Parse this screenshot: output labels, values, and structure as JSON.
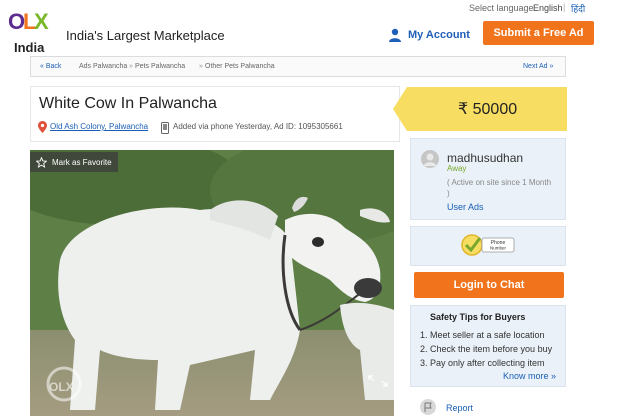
{
  "header": {
    "logo_text": "OLX",
    "country": "India",
    "tagline": "India's Largest Marketplace",
    "language_label": "Select language",
    "lang_english": "English",
    "lang_separator": "|",
    "lang_hindi": "हिंदी",
    "my_account": "My Account",
    "submit_ad": "Submit a Free Ad"
  },
  "breadcrumb": {
    "back": "« Back",
    "items": [
      "Ads Palwancha",
      "Pets Palwancha",
      "Other Pets Palwancha"
    ],
    "separator": "»",
    "next": "Next Ad »"
  },
  "ad": {
    "title": "White Cow In Palwancha",
    "location": "Old Ash Colony, Palwancha",
    "added": "Added via phone Yesterday, Ad ID: 1095305661",
    "price": "₹ 50000",
    "favorite": "Mark as Favorite",
    "watermark": "OLX"
  },
  "seller": {
    "name": "madhusudhan",
    "status": "Away",
    "active_since": "( Active on site since 1 Month )",
    "user_ads": "User Ads",
    "verified_badge": "Phone Number Verified"
  },
  "chat_button": "Login to Chat",
  "safety": {
    "title": "Safety Tips for Buyers",
    "tips": [
      "1. Meet seller at a safe location",
      "2. Check the item before you buy",
      "3. Pay only after collecting item"
    ],
    "know_more": "Know more »"
  },
  "report": "Report",
  "colors": {
    "accent_orange": "#f1731c",
    "link_blue": "#1a5fb4",
    "price_yellow": "#f7dd62",
    "panel_blue": "#eaf1f8"
  }
}
